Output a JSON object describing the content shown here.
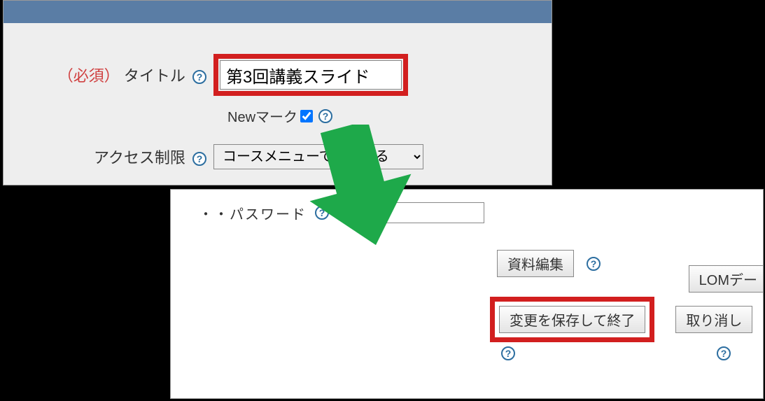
{
  "top": {
    "required_label": "（必須）",
    "title_label": "タイトル",
    "title_value": "第3回講義スライド",
    "new_mark_label": "Newマーク",
    "new_mark_checked": true,
    "access_label": "アクセス制限",
    "access_value": "コースメニューで表示する"
  },
  "bottom": {
    "password_label_partial": "・・パスワード",
    "edit_button": "資料編集",
    "save_button": "変更を保存して終了",
    "cancel_button": "取り消し",
    "lom_button": "LOMデー"
  }
}
